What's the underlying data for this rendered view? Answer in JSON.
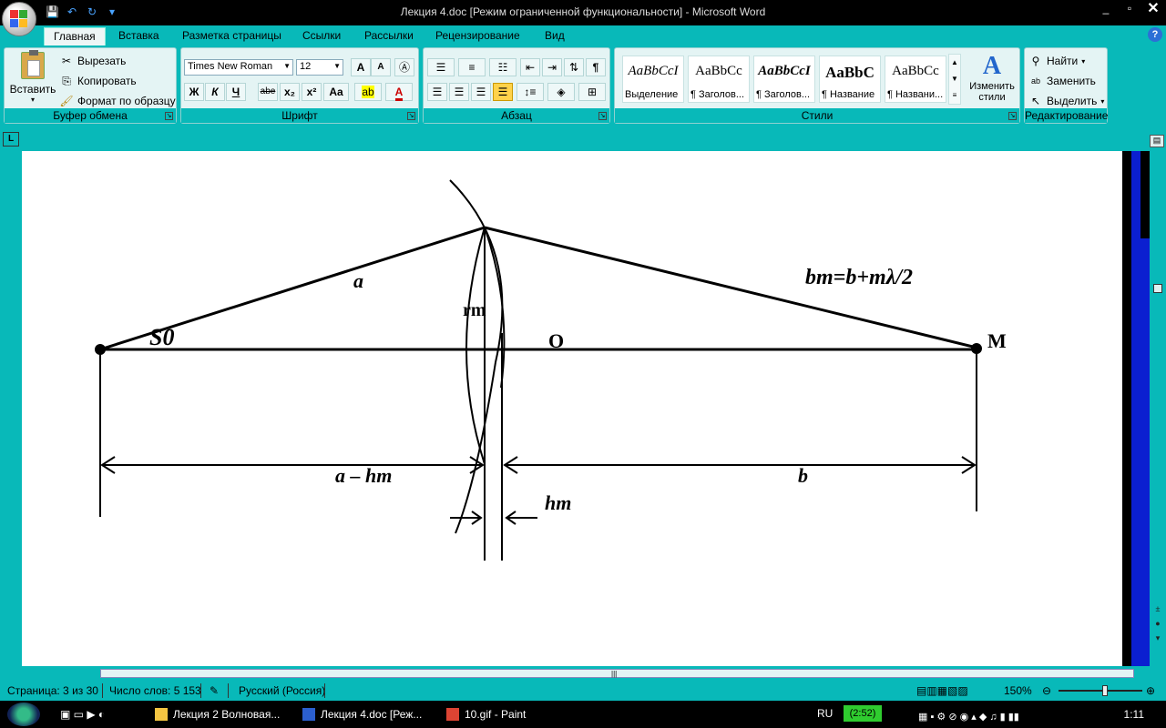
{
  "window": {
    "title": "Лекция 4.doc [Режим ограниченной функциональности] - Microsoft Word",
    "controls": {
      "minimize": "_",
      "maximize": "▫",
      "close": "✕"
    }
  },
  "tabs": [
    "Главная",
    "Вставка",
    "Разметка страницы",
    "Ссылки",
    "Рассылки",
    "Рецензирование",
    "Вид"
  ],
  "ribbon": {
    "clipboard": {
      "label": "Буфер обмена",
      "paste": "Вставить",
      "cut": "Вырезать",
      "copy": "Копировать",
      "format_painter": "Формат по образцу"
    },
    "font": {
      "label": "Шрифт",
      "font_name": "Times New Roman",
      "font_size": "12",
      "bold": "Ж",
      "italic": "К",
      "underline": "Ч",
      "strike": "abe",
      "subscript": "x₂",
      "superscript": "x²",
      "case": "Aa",
      "grow": "A",
      "shrink": "A"
    },
    "paragraph": {
      "label": "Абзац",
      "pilcrow": "¶"
    },
    "styles": {
      "label": "Стили",
      "items": [
        {
          "sample": "AaBbCcI",
          "name": "Выделение"
        },
        {
          "sample": "AaBbCc",
          "name": "¶ Заголов..."
        },
        {
          "sample": "AaBbCcI",
          "name": "¶ Заголов..."
        },
        {
          "sample": "AaBbC",
          "name": "¶ Название"
        },
        {
          "sample": "AaBbCc",
          "name": "¶ Названи..."
        }
      ],
      "change_styles": "Изменить стили"
    },
    "editing": {
      "label": "Редактирование",
      "find": "Найти",
      "replace": "Заменить",
      "select": "Выделить"
    }
  },
  "diagram": {
    "label_a": "a",
    "label_bm": "bm=b+mλ/2",
    "label_rm": "rm",
    "label_s0": "S0",
    "label_o": "O",
    "label_m": "M",
    "label_a_minus_hm": "a – hm",
    "label_b": "b",
    "label_hm": "hm"
  },
  "statusbar": {
    "page": "Страница: 3 из 30",
    "words": "Число слов: 5 153",
    "language": "Русский (Россия)",
    "zoom": "150%"
  },
  "taskbar": {
    "items": [
      "Лекция 2 Волновая...",
      "Лекция 4.doc [Реж...",
      "10.gif - Paint"
    ],
    "lang": "RU",
    "badge": "(2:52)",
    "clock": "1:11"
  },
  "colors": {
    "accent": "#08b9b9",
    "titlebar": "#000000",
    "page": "#ffffff",
    "margin_blue": "#0b1fd0"
  }
}
